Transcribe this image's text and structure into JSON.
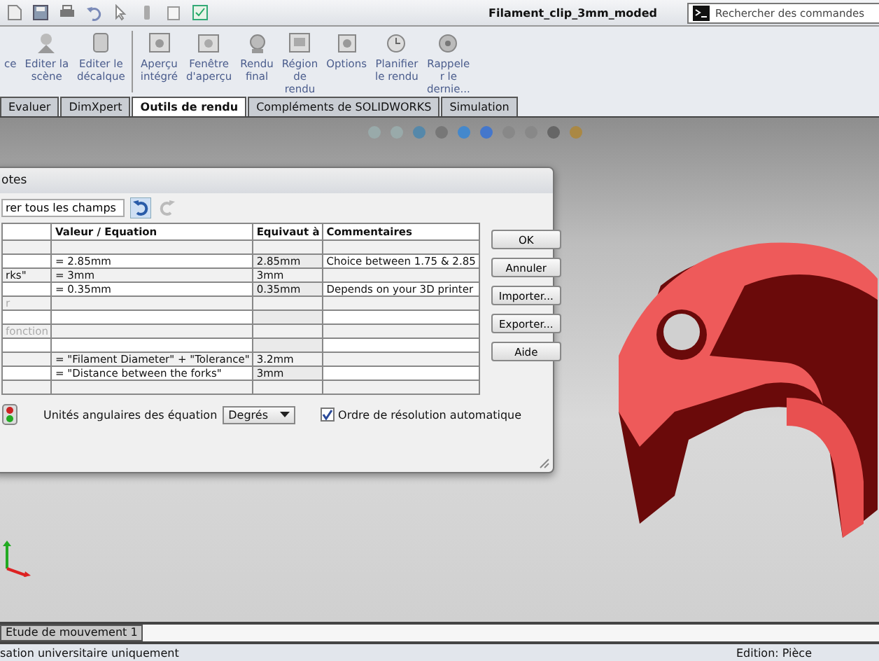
{
  "title_bar": {
    "title": "Filament_clip_3mm_moded",
    "search": {
      "placeholder": "Rechercher des commandes"
    }
  },
  "ribbon": {
    "items": [
      {
        "lines": [
          "ce"
        ],
        "separator_before": false
      },
      {
        "lines": [
          "Editer la",
          "scène"
        ],
        "separator_before": false
      },
      {
        "lines": [
          "Editer le",
          "décalque"
        ],
        "separator_before": false
      },
      {
        "lines": [
          "Aperçu",
          "intégré"
        ],
        "separator_before": true
      },
      {
        "lines": [
          "Fenêtre",
          "d'aperçu"
        ],
        "separator_before": false
      },
      {
        "lines": [
          "Rendu",
          "final"
        ],
        "separator_before": false
      },
      {
        "lines": [
          "Région",
          "de",
          "rendu"
        ],
        "separator_before": false
      },
      {
        "lines": [
          "Options"
        ],
        "separator_before": false
      },
      {
        "lines": [
          "Planifier",
          "le rendu"
        ],
        "separator_before": false
      },
      {
        "lines": [
          "Rappele",
          "r le",
          "dernie..."
        ],
        "separator_before": false
      }
    ]
  },
  "tabs": [
    {
      "label": "Evaluer",
      "selected": false
    },
    {
      "label": "DimXpert",
      "selected": false
    },
    {
      "label": "Outils de rendu",
      "selected": true
    },
    {
      "label": "Compléments de SOLIDWORKS",
      "selected": false
    },
    {
      "label": "Simulation",
      "selected": false
    }
  ],
  "dialog": {
    "title": "otes",
    "filter": {
      "value": "rer tous les champs"
    },
    "table": {
      "columns": [
        "",
        "Valeur / Equation",
        "Equivaut à",
        "Commentaires"
      ],
      "rows": [
        {
          "kind": "normal",
          "cells": [
            "",
            "",
            "",
            ""
          ]
        },
        {
          "kind": "normal",
          "cells": [
            "",
            "= 2.85mm",
            "2.85mm",
            "Choice between 1.75 & 2.85"
          ]
        },
        {
          "kind": "normal",
          "cells": [
            "rks\"",
            "= 3mm",
            "3mm",
            ""
          ]
        },
        {
          "kind": "normal",
          "cells": [
            "",
            "= 0.35mm",
            "0.35mm",
            "Depends on your 3D printer"
          ]
        },
        {
          "kind": "hint",
          "cells": [
            "r",
            "",
            "",
            ""
          ]
        },
        {
          "kind": "normal",
          "cells": [
            "",
            "",
            "",
            ""
          ]
        },
        {
          "kind": "hint",
          "cells": [
            "fonction",
            "",
            "",
            ""
          ]
        },
        {
          "kind": "normal",
          "cells": [
            "",
            "",
            "",
            ""
          ]
        },
        {
          "kind": "normal",
          "cells": [
            "",
            "= \"Filament Diameter\" + \"Tolerance\"",
            "3.2mm",
            ""
          ]
        },
        {
          "kind": "normal",
          "cells": [
            "",
            "= \"Distance between the forks\"",
            "3mm",
            ""
          ]
        },
        {
          "kind": "normal",
          "cells": [
            "",
            "",
            "",
            ""
          ]
        }
      ]
    },
    "buttons": [
      "OK",
      "Annuler",
      "Importer...",
      "Exporter...",
      "Aide"
    ],
    "angle_units": {
      "label": "Unités angulaires des équation",
      "value": "Degrés"
    },
    "auto_order": {
      "label": "Ordre de résolution automatique",
      "checked": true
    }
  },
  "motion_tab": {
    "label": "Etude de mouvement 1"
  },
  "status_bar": {
    "left": "sation universitaire uniquement",
    "right": "Edition: Pièce"
  }
}
